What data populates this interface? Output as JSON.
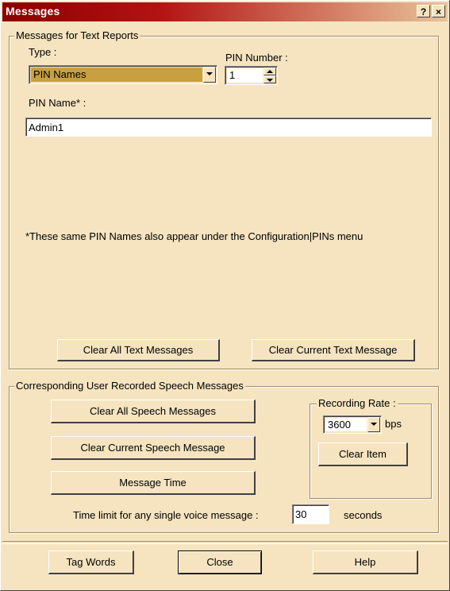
{
  "window": {
    "title": "Messages",
    "help_glyph": "?",
    "close_glyph": "×"
  },
  "text_reports": {
    "legend": "Messages for Text Reports",
    "type_label": "Type :",
    "type_value": "PIN Names",
    "pin_number_label": "PIN Number :",
    "pin_number_value": "1",
    "pin_name_label": "PIN Name* :",
    "pin_name_value": "Admin1",
    "note": "*These same PIN Names also appear under the Configuration|PINs menu",
    "clear_all_label": "Clear All Text Messages",
    "clear_current_label": "Clear Current Text Message"
  },
  "speech": {
    "legend": "Corresponding User Recorded Speech Messages",
    "clear_all_label": "Clear All Speech Messages",
    "clear_current_label": "Clear Current Speech Message",
    "message_time_label": "Message Time",
    "recording_rate_legend": "Recording Rate :",
    "rate_value": "3600",
    "rate_unit": "bps",
    "clear_item_label": "Clear Item",
    "time_limit_label": "Time limit for any single voice message :",
    "time_limit_value": "30",
    "time_limit_unit": "seconds"
  },
  "footer": {
    "tag_words_label": "Tag Words",
    "close_label": "Close",
    "help_label": "Help"
  },
  "colors": {
    "dialog_bg": "#f6e4c0",
    "title_start": "#8b0000",
    "selected_type_bg": "#c8a040"
  }
}
